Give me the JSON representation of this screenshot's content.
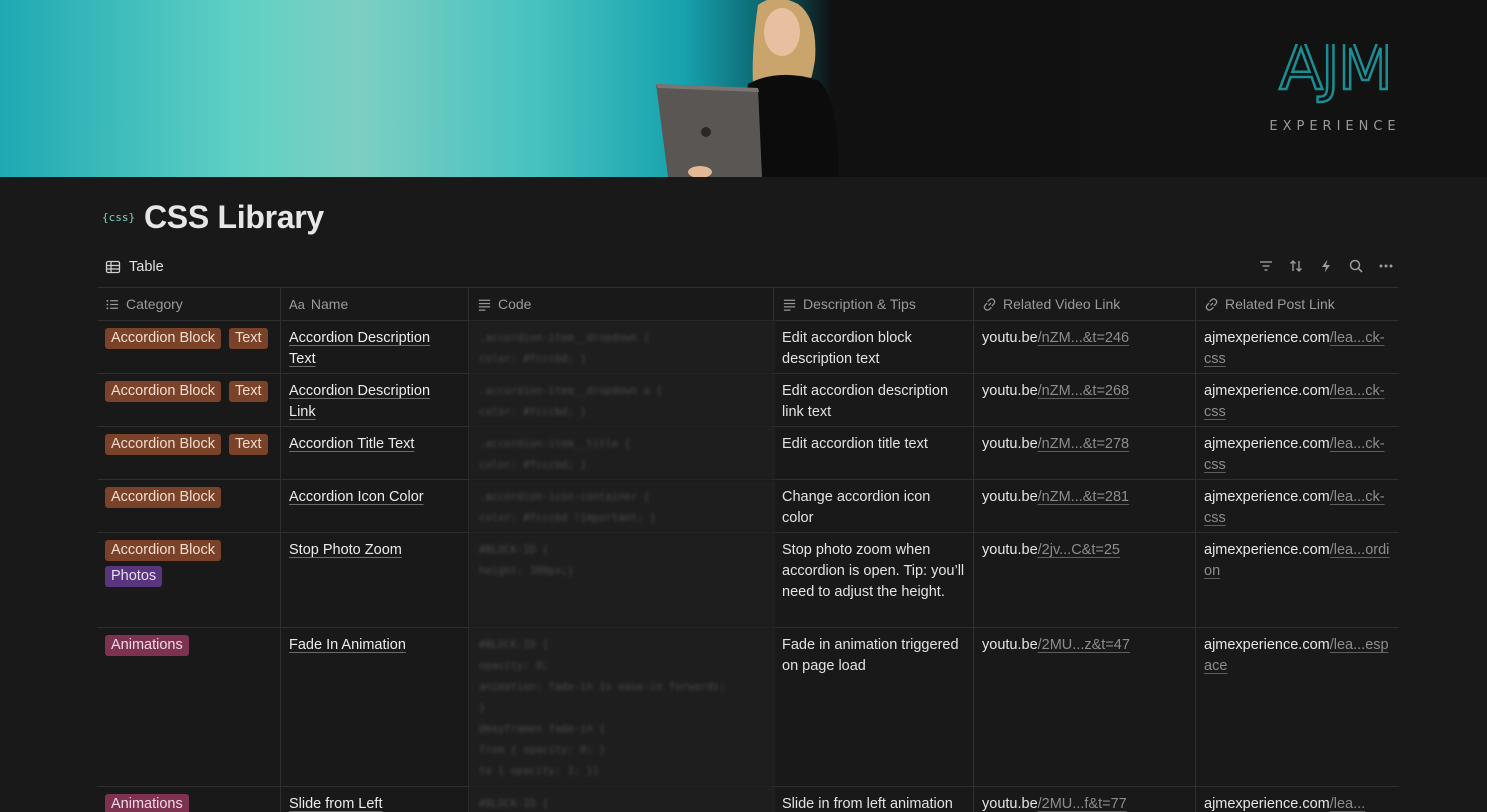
{
  "banner": {
    "logo_text": "AJM",
    "logo_subtext": "EXPERIENCE"
  },
  "page": {
    "icon_text": "{css}",
    "title": "CSS Library"
  },
  "view": {
    "tab_label": "Table"
  },
  "toolbar_icons": [
    "filter-icon",
    "sort-icon",
    "automation-icon",
    "search-icon",
    "more-icon"
  ],
  "columns": [
    {
      "label": "Category",
      "icon": "list-icon"
    },
    {
      "label": "Name",
      "icon": "text-aa-icon"
    },
    {
      "label": "Code",
      "icon": "text-lines-icon"
    },
    {
      "label": "Description & Tips",
      "icon": "text-lines-icon"
    },
    {
      "label": "Related Video Link",
      "icon": "link-icon"
    },
    {
      "label": "Related Post Link",
      "icon": "link-icon"
    }
  ],
  "name_col_prefix": "Aa",
  "tag_colors": {
    "Accordion Block": {
      "bg": "#7a4228",
      "fg": "#f1dccf"
    },
    "Text": {
      "bg": "#7a4228",
      "fg": "#f1dccf"
    },
    "Photos": {
      "bg": "#59357e",
      "fg": "#e8dcf5"
    },
    "Animations": {
      "bg": "#7c3250",
      "fg": "#f5dbe5"
    }
  },
  "rows": [
    {
      "tags": [
        "Accordion Block",
        "Text"
      ],
      "name": "Accordion Description Text",
      "code": [
        ".accordion-item__dropdown {",
        "color: #fcccbd; }"
      ],
      "description": "Edit accordion block description text",
      "video_host": "youtu.be",
      "video_path": "/nZM...&t=246",
      "post_host": "ajmexperience.com",
      "post_path": "/lea...ck-css"
    },
    {
      "tags": [
        "Accordion Block",
        "Text"
      ],
      "name": "Accordion Description Link",
      "code": [
        ".accordion-item__dropdown a {",
        "color: #fcccbd; }"
      ],
      "description": "Edit accordion description link text",
      "video_host": "youtu.be",
      "video_path": "/nZM...&t=268",
      "post_host": "ajmexperience.com",
      "post_path": "/lea...ck-css"
    },
    {
      "tags": [
        "Accordion Block",
        "Text"
      ],
      "name": "Accordion Title Text",
      "code": [
        ".accordion-item__title {",
        "color: #fcccbd; }"
      ],
      "description": "Edit accordion title text",
      "video_host": "youtu.be",
      "video_path": "/nZM...&t=278",
      "post_host": "ajmexperience.com",
      "post_path": "/lea...ck-css"
    },
    {
      "tags": [
        "Accordion Block"
      ],
      "name": "Accordion Icon Color",
      "code": [
        ".accordion-icon-container {",
        "color: #fcccbd !important; }"
      ],
      "description": "Change accordion icon color",
      "video_host": "youtu.be",
      "video_path": "/nZM...&t=281",
      "post_host": "ajmexperience.com",
      "post_path": "/lea...ck-css"
    },
    {
      "tags": [
        "Accordion Block",
        "Photos"
      ],
      "name": "Stop Photo Zoom",
      "code": [
        "#BLOCK-ID {",
        "height: 300px;}"
      ],
      "description": "Stop photo zoom when accordion is open. Tip: you’ll need to adjust the height.",
      "video_host": "youtu.be",
      "video_path": "/2jv...C&t=25",
      "post_host": "ajmexperience.com",
      "post_path": "/lea...ordion"
    },
    {
      "tags": [
        "Animations"
      ],
      "name": "Fade In Animation",
      "code": [
        "#BLOCK-ID {",
        "opacity: 0;",
        "animation: fade-in 1s ease-in forwards;",
        "}",
        "@keyframes fade-in {",
        "from { opacity: 0; }",
        "to { opacity: 1; }}"
      ],
      "description": "Fade in animation triggered on page load",
      "video_host": "youtu.be",
      "video_path": "/2MU...z&t=47",
      "post_host": "ajmexperience.com",
      "post_path": "/lea...espace"
    },
    {
      "tags": [
        "Animations"
      ],
      "name": "Slide from Left",
      "code": [
        "#BLOCK-ID {"
      ],
      "description": "Slide in from left animation",
      "video_host": "youtu.be",
      "video_path": "/2MU...f&t=77",
      "post_host": "ajmexperience.com",
      "post_path": "/lea..."
    }
  ]
}
